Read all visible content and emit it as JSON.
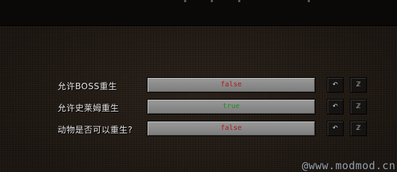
{
  "settings": [
    {
      "label": "允许BOSS重生",
      "value": "false"
    },
    {
      "label": "允许史莱姆重生",
      "value": "true"
    },
    {
      "label": "动物是否可以重生?",
      "value": "false"
    }
  ],
  "icons": {
    "undo": "undo-icon",
    "reset": "reset-icon",
    "undo_glyph": "↶",
    "reset_glyph": "ℤ"
  },
  "colors": {
    "false_value": "#b11a1a",
    "true_value": "#1f8f1f",
    "label_text": "#e6e6e6",
    "button_face": "#8a8a8a"
  },
  "watermark": "@www.modmod.cn"
}
